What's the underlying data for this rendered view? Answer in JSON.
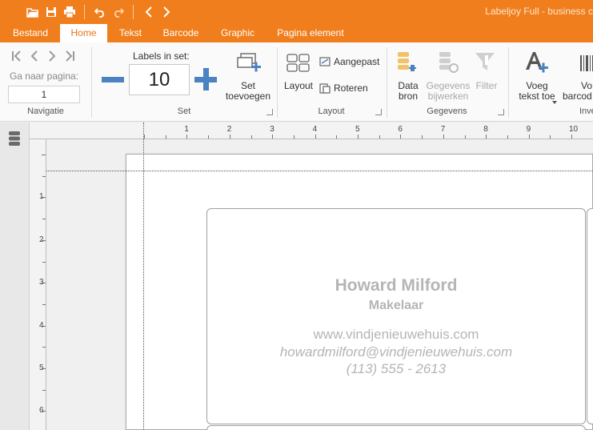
{
  "app": {
    "title": "Labeljoy Full - business c",
    "accent": "#f07e1c"
  },
  "quick_access": [
    {
      "name": "open-icon"
    },
    {
      "name": "save-icon"
    },
    {
      "name": "print-icon"
    },
    {
      "name": "undo-icon"
    },
    {
      "name": "redo-icon"
    },
    {
      "name": "back-icon"
    },
    {
      "name": "forward-icon"
    }
  ],
  "tabs": [
    "Bestand",
    "Home",
    "Tekst",
    "Barcode",
    "Graphic",
    "Pagina element"
  ],
  "active_tab": "Home",
  "ribbon": {
    "navigatie": {
      "goto_label": "Ga naar pagina:",
      "page_value": "1",
      "group_label": "Navigatie"
    },
    "set": {
      "labels_in_set_label": "Labels in set:",
      "labels_count": "10",
      "set_toevoegen_line1": "Set",
      "set_toevoegen_line2": "toevoegen",
      "group_label": "Set"
    },
    "layout": {
      "layout_label": "Layout",
      "aangepast_label": "Aangepast",
      "roteren_label": "Roteren",
      "group_label": "Layout"
    },
    "gegevens": {
      "data_bron_line1": "Data",
      "data_bron_line2": "bron",
      "gegevens_bijwerken_line1": "Gegevens",
      "gegevens_bijwerken_line2": "bijwerken",
      "filter_label": "Filter",
      "group_label": "Gegevens"
    },
    "invoegen": {
      "voeg_tekst_line1": "Voeg",
      "voeg_tekst_line2": "tekst toe",
      "voeg_barcode_line1": "Vo",
      "voeg_barcode_line2": "barcod",
      "group_label": "Inve"
    }
  },
  "rulers": {
    "horizontal_ticks": [
      "1",
      "2",
      "3",
      "4",
      "5",
      "6",
      "7",
      "8",
      "9",
      "10"
    ],
    "vertical_ticks": [
      "1",
      "2",
      "3",
      "4",
      "5",
      "6"
    ]
  },
  "label": {
    "name": "Howard Milford",
    "role": "Makelaar",
    "website": "www.vindjenieuwehuis.com",
    "email": "howardmilford@vindjenieuwehuis.com",
    "phone": "(113) 555 - 2613"
  }
}
